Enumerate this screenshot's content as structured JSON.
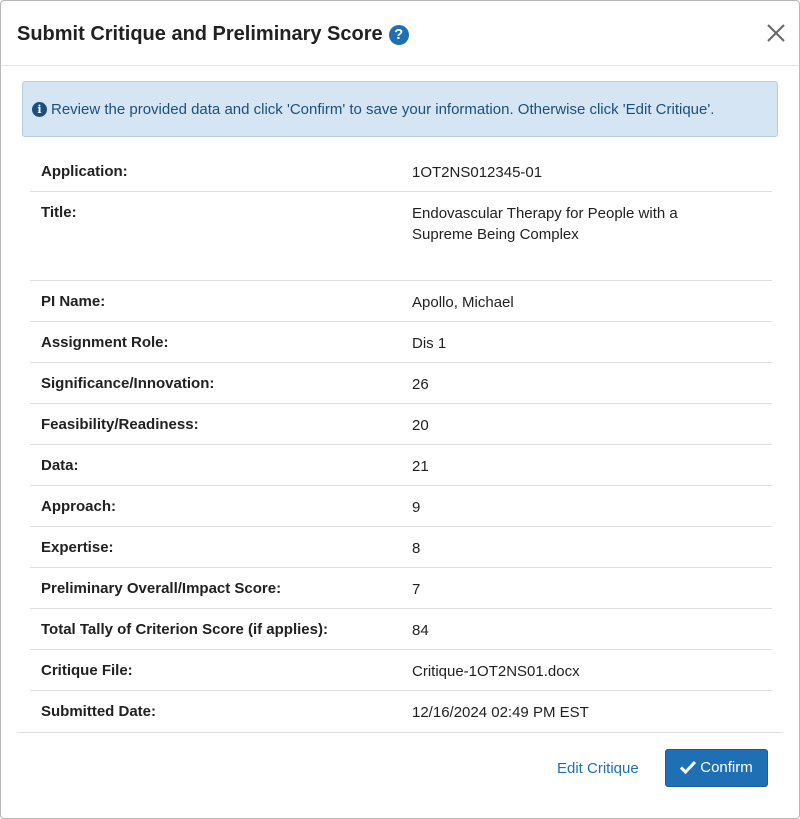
{
  "dialog": {
    "title": "Submit Critique and Preliminary Score",
    "help_icon": "question-circle-icon",
    "close_icon": "close-icon"
  },
  "alert": {
    "icon": "info-circle-icon",
    "text": "Review the provided data and click 'Confirm' to save your information. Otherwise click 'Edit Critique'."
  },
  "details": [
    {
      "label": "Application:",
      "value": "1OT2NS012345-01"
    },
    {
      "label": "Title:",
      "value": "Endovascular Therapy for People with a Supreme Being Complex"
    },
    {
      "label": "PI Name:",
      "value": "Apollo, Michael"
    },
    {
      "label": "Assignment Role:",
      "value": "Dis 1"
    },
    {
      "label": "Significance/Innovation:",
      "value": "26"
    },
    {
      "label": "Feasibility/Readiness:",
      "value": "20"
    },
    {
      "label": "Data:",
      "value": "21"
    },
    {
      "label": "Approach:",
      "value": "9"
    },
    {
      "label": "Expertise:",
      "value": "8"
    },
    {
      "label": "Preliminary Overall/Impact Score:",
      "value": "7"
    },
    {
      "label": "Total Tally of Criterion Score (if applies):",
      "value": "84"
    },
    {
      "label": "Critique File:",
      "value": "Critique-1OT2NS01.docx"
    },
    {
      "label": "Submitted Date:",
      "value": "12/16/2024 02:49 PM EST"
    }
  ],
  "footer": {
    "edit_label": "Edit Critique",
    "confirm_label": "Confirm",
    "confirm_icon": "check-icon"
  },
  "colors": {
    "primary": "#1f6fb5",
    "alert_bg": "#d5e5f3",
    "alert_text": "#1d4f7a"
  }
}
